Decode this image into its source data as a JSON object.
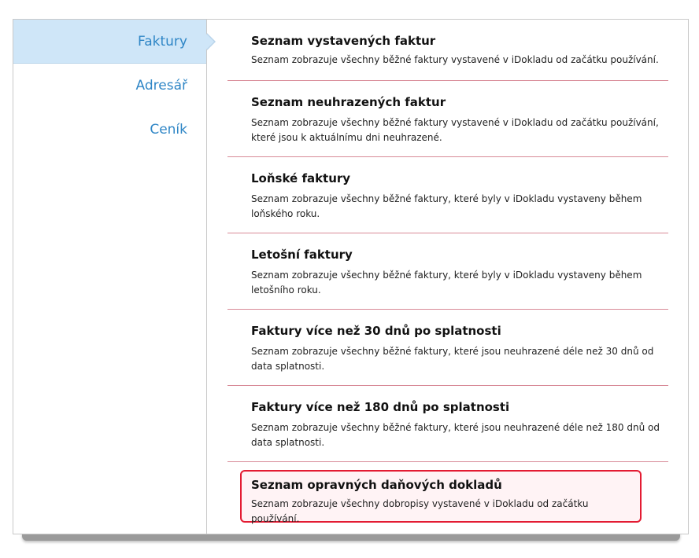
{
  "sidebar": {
    "items": [
      {
        "label": "Faktury",
        "active": true
      },
      {
        "label": "Adresář",
        "active": false
      },
      {
        "label": "Ceník",
        "active": false
      }
    ]
  },
  "reports": [
    {
      "title": "Seznam vystavených faktur",
      "description": "Seznam zobrazuje všechny běžné faktury vystavené v iDokladu od začátku používání."
    },
    {
      "title": "Seznam neuhrazených faktur",
      "description": "Seznam zobrazuje všechny běžné faktury vystavené v iDokladu od začátku používání, které jsou k aktuálnímu dni neuhrazené."
    },
    {
      "title": "Loňské faktury",
      "description": "Seznam zobrazuje všechny běžné faktury, které byly v iDokladu vystaveny během loňského roku."
    },
    {
      "title": "Letošní faktury",
      "description": "Seznam zobrazuje všechny běžné faktury, které byly v iDokladu vystaveny během letošního roku."
    },
    {
      "title": "Faktury více než 30 dnů po splatnosti",
      "description": "Seznam zobrazuje všechny běžné faktury, které jsou neuhrazené déle než 30 dnů od data splatnosti."
    },
    {
      "title": "Faktury více než 180 dnů po splatnosti",
      "description": "Seznam zobrazuje všechny běžné faktury, které jsou neuhrazené déle než 180 dnů od data splatnosti."
    },
    {
      "title": "Seznam opravných daňových dokladů",
      "description": "Seznam zobrazuje všechny dobropisy vystavené v iDokladu od začátku používání.",
      "highlighted": true
    }
  ],
  "colors": {
    "accent": "#2f86c6",
    "active_bg": "#cfe6f8",
    "divider": "#d88a97",
    "highlight_border": "#e31b32"
  }
}
